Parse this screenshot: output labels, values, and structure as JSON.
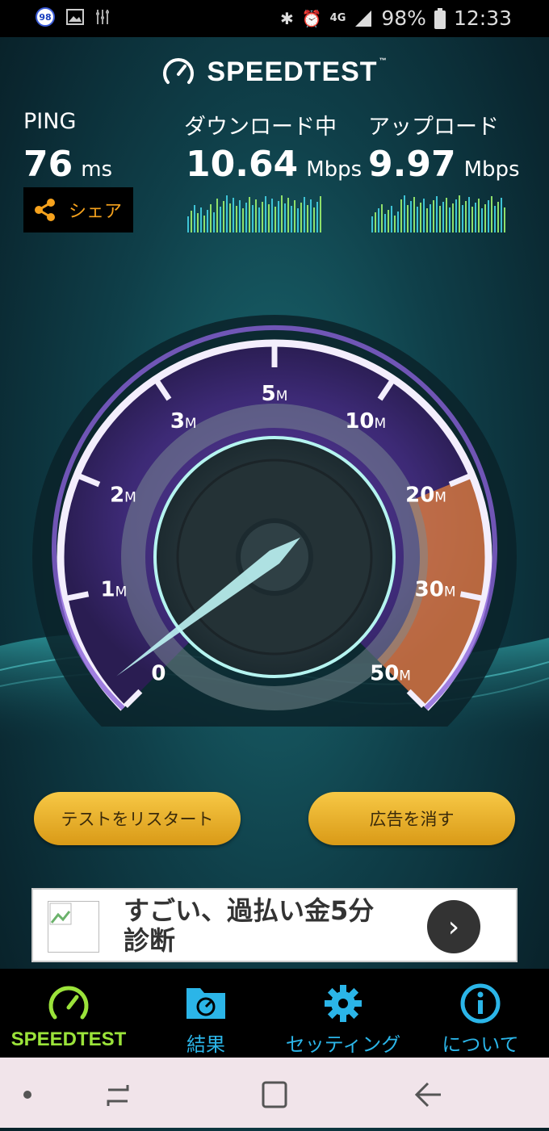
{
  "status_bar": {
    "badge": "98",
    "network": "4G",
    "battery": "98%",
    "time": "12:33",
    "left_icons": [
      "notification-badge-icon",
      "image-icon",
      "usb-debug-icon"
    ],
    "right_icons": [
      "bluetooth-icon",
      "alarm-icon",
      "signal-icon",
      "battery-icon"
    ]
  },
  "header": {
    "logo_text": "SPEEDTEST",
    "trademark": "™"
  },
  "ping": {
    "label": "PING",
    "value": "76",
    "unit": "ms"
  },
  "download": {
    "label": "ダウンロード中",
    "value": "10.64",
    "unit": "Mbps"
  },
  "upload": {
    "label": "アップロード",
    "value": "9.97",
    "unit": "Mbps"
  },
  "share": {
    "label": "シェア"
  },
  "gauge": {
    "ticks": [
      {
        "num": "0",
        "unit": ""
      },
      {
        "num": "1",
        "unit": "M"
      },
      {
        "num": "2",
        "unit": "M"
      },
      {
        "num": "3",
        "unit": "M"
      },
      {
        "num": "5",
        "unit": "M"
      },
      {
        "num": "10",
        "unit": "M"
      },
      {
        "num": "20",
        "unit": "M"
      },
      {
        "num": "30",
        "unit": "M"
      },
      {
        "num": "50",
        "unit": "M"
      }
    ],
    "current_value_mbps": 10.64,
    "needle_color": "#bdf3f3",
    "arc_color": "#8a62d8",
    "high_range_color": "#e8813a"
  },
  "buttons": {
    "restart": "テストをリスタート",
    "remove_ads": "広告を消す"
  },
  "ad": {
    "text_line1": "すごい、過払い金5分",
    "text_line2": "診断"
  },
  "tabs": [
    {
      "label": "SPEEDTEST",
      "icon": "speedometer-icon",
      "color": "#9be33a",
      "active": true
    },
    {
      "label": "結果",
      "icon": "results-folder-icon",
      "color": "#2bb5e8",
      "active": false
    },
    {
      "label": "セッティング",
      "icon": "gear-icon",
      "color": "#2bb5e8",
      "active": false
    },
    {
      "label": "について",
      "icon": "info-icon",
      "color": "#2bb5e8",
      "active": false
    }
  ],
  "nav": {
    "icons": [
      "dot-icon",
      "recents-icon",
      "home-icon",
      "back-icon"
    ]
  }
}
